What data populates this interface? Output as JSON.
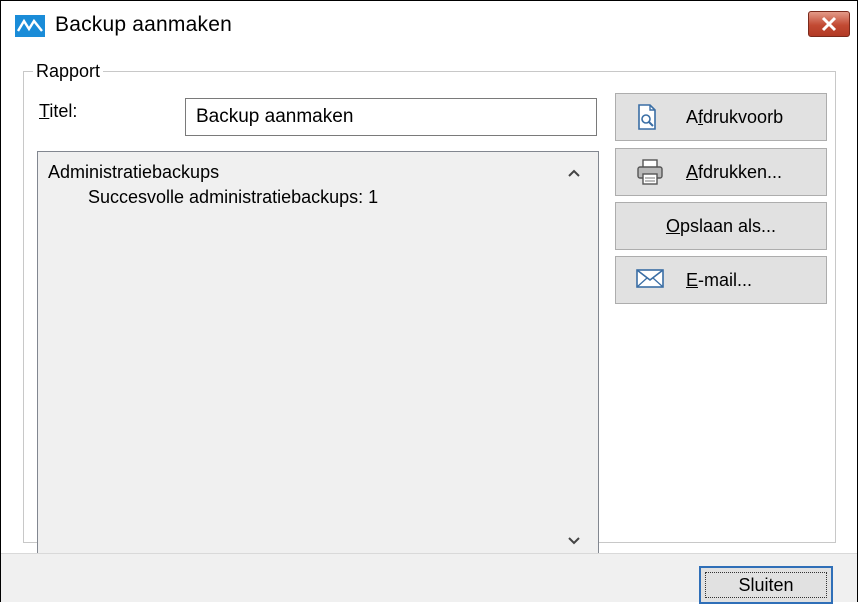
{
  "window": {
    "title": "Backup aanmaken",
    "accent": "#1a8cd8",
    "close_color": "#c24a33"
  },
  "group": {
    "label": "Rapport"
  },
  "title_field": {
    "label_mnemonic": "T",
    "label_rest": "itel:",
    "value": "Backup aanmaken"
  },
  "report": {
    "heading": "Administratiebackups",
    "line": "Succesvolle administratiebackups: 1"
  },
  "buttons": {
    "preview": {
      "mnemonic": "f",
      "pre": "A",
      "post": "drukvoorb",
      "icon": "print-preview-icon"
    },
    "print": {
      "mnemonic": "A",
      "pre": "",
      "post": "fdrukken...",
      "icon": "printer-icon"
    },
    "save": {
      "mnemonic": "O",
      "pre": "",
      "post": "pslaan als..."
    },
    "email": {
      "mnemonic": "E",
      "pre": "",
      "post": "-mail...",
      "icon": "envelope-icon"
    }
  },
  "footer": {
    "close_label": "Sluiten"
  }
}
